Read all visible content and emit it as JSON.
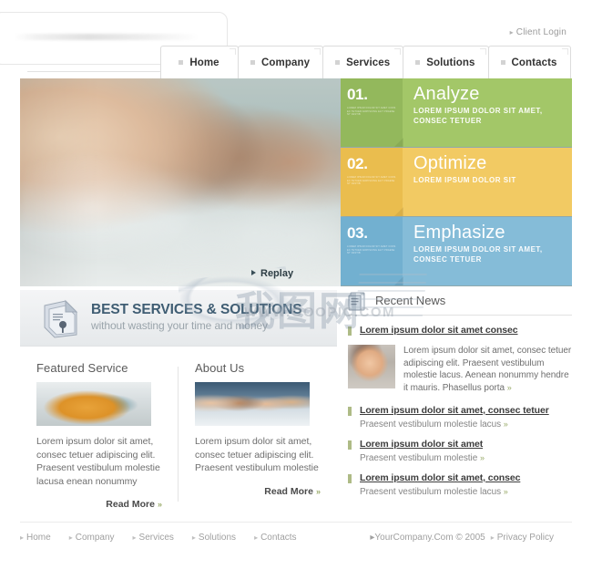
{
  "header": {
    "client_login": "Client Login",
    "client_login_arrow": "▸",
    "logo_alt": "company-logo"
  },
  "nav": {
    "tabs": [
      {
        "label": "Home"
      },
      {
        "label": "Company"
      },
      {
        "label": "Services"
      },
      {
        "label": "Solutions"
      },
      {
        "label": "Contacts"
      }
    ]
  },
  "hero": {
    "replay_label": "Replay",
    "panels": [
      {
        "number": "01.",
        "title": "Analyze",
        "subtitle": "LOREM IPSUM DOLOR SIT AMET, CONSEC TETUER",
        "micro": "LOREM IPSUM DOLOR SIT AMET CONSEC TETUER ADIPISCING ELIT PRAESENT VESTIB",
        "color": "#a3c768",
        "num_color": "#93b85c"
      },
      {
        "number": "02.",
        "title": "Optimize",
        "subtitle": "LOREM IPSUM DOLOR SIT",
        "micro": "LOREM IPSUM DOLOR SIT AMET CONSEC TETUER ADIPISCING ELIT PRAESENT VESTIB",
        "color": "#f2ca63",
        "num_color": "#eabd4e"
      },
      {
        "number": "03.",
        "title": "Emphasize",
        "subtitle": "LOREM IPSUM DOLOR SIT AMET, CONSEC TETUER",
        "micro": "LOREM IPSUM DOLOR SIT AMET CONSEC TETUER ADIPISCING ELIT PRAESENT VESTIB",
        "color": "#85bcd8",
        "num_color": "#72b0d0"
      }
    ]
  },
  "banner": {
    "headline": "BEST SERVICES & SOLUTIONS",
    "tagline": "without wasting your time and money",
    "icon": "document-stack-icon"
  },
  "columns": [
    {
      "title": "Featured Service",
      "image": "featured-service-thumbnail",
      "body": "Lorem ipsum dolor sit amet, consec tetuer adipiscing elit. Praesent vestibulum molestie lacusa enean nonummy",
      "read_more": "Read More",
      "read_more_chevron": "»"
    },
    {
      "title": "About Us",
      "image": "about-us-thumbnail",
      "body": "Lorem ipsum dolor sit amet, consec tetuer adipiscing elit. Praesent vestibulum molestie",
      "read_more": "Read More",
      "read_more_chevron": "»"
    }
  ],
  "news": {
    "title": "Recent News",
    "icon": "news-document-icon",
    "lead": {
      "headline": "Lorem ipsum dolor sit amet consec",
      "image": "news-headset-avatar",
      "body": "Lorem ipsum dolor sit amet, consec tetuer adipiscing elit. Praesent vestibulum molestie lacus. Aenean nonummy hendre it mauris. Phasellus porta",
      "chevron": "»"
    },
    "items": [
      {
        "headline": "Lorem ipsum dolor sit amet, consec tetuer",
        "desc": "Praesent vestibulum molestie lacus",
        "chevron": "»"
      },
      {
        "headline": "Lorem ipsum dolor sit amet",
        "desc": "Praesent vestibulum molestie",
        "chevron": "»"
      },
      {
        "headline": "Lorem ipsum dolor sit amet, consec",
        "desc": "Praesent vestibulum molestie lacus",
        "chevron": "»"
      }
    ]
  },
  "footer": {
    "links": [
      {
        "label": "Home"
      },
      {
        "label": "Company"
      },
      {
        "label": "Services"
      },
      {
        "label": "Solutions"
      },
      {
        "label": "Contacts"
      }
    ],
    "arrow": "▸",
    "copyright": "YourCompany.Com © 2005",
    "privacy": "Privacy Policy"
  },
  "watermark": {
    "cjk": "我图网",
    "url": "WWW.OOOPIC.COM"
  }
}
